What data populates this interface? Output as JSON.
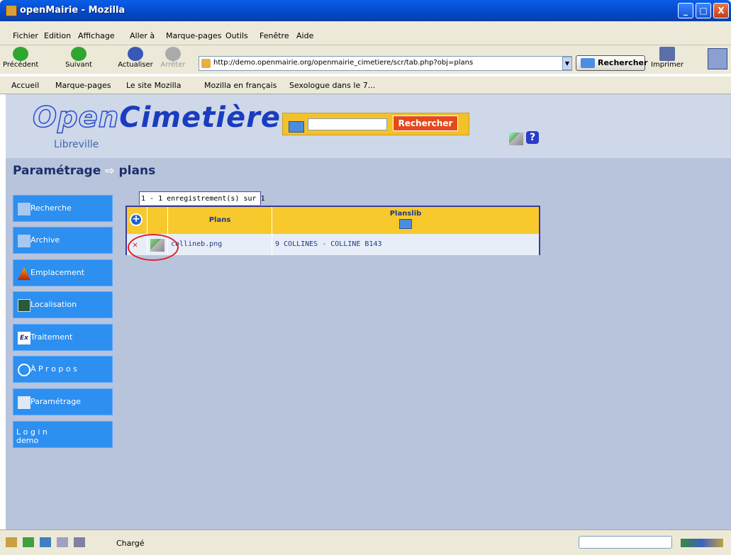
{
  "window": {
    "title": "openMairie - Mozilla",
    "minimize": "_",
    "maximize": "□",
    "close": "X"
  },
  "menu": [
    "Fichier",
    "Edition",
    "Affichage",
    "Aller à",
    "Marque-pages",
    "Outils",
    "Fenêtre",
    "Aide"
  ],
  "toolbar": {
    "back": "Précédent",
    "forward": "Suivant",
    "reload": "Actualiser",
    "stop": "Arrêter",
    "url": "http://demo.openmairie.org/openmairie_cimetiere/scr/tab.php?obj=plans",
    "search": "Rechercher",
    "print": "Imprimer"
  },
  "bookmarks": [
    "Accueil",
    "Marque-pages",
    "Le site Mozilla",
    "Mozilla en français",
    "Sexologue dans le 7..."
  ],
  "header": {
    "logo_open": "Open",
    "logo_cimetiere": "Cimetière",
    "city": "Libreville",
    "search_button": "Rechercher",
    "help": "?"
  },
  "breadcrumb": {
    "section": "Paramétrage",
    "arrow": "⇨",
    "page": "plans"
  },
  "sidebar": [
    {
      "label": "Recherche"
    },
    {
      "label": "Archive"
    },
    {
      "label": "Emplacement"
    },
    {
      "label": "Localisation"
    },
    {
      "label": "Traitement"
    },
    {
      "label": "À P r o p o s"
    },
    {
      "label": "Paramétrage"
    },
    {
      "label": "L o g i n",
      "sub": "demo"
    }
  ],
  "table": {
    "pagination": "1 - 1 enregistrement(s) sur 1",
    "columns": [
      "Plans",
      "Planslib"
    ],
    "rows": [
      {
        "plans": "collineb.png",
        "planslib": "9 COLLINES - COLLINE B143"
      }
    ]
  },
  "status": {
    "text": "Chargé"
  }
}
